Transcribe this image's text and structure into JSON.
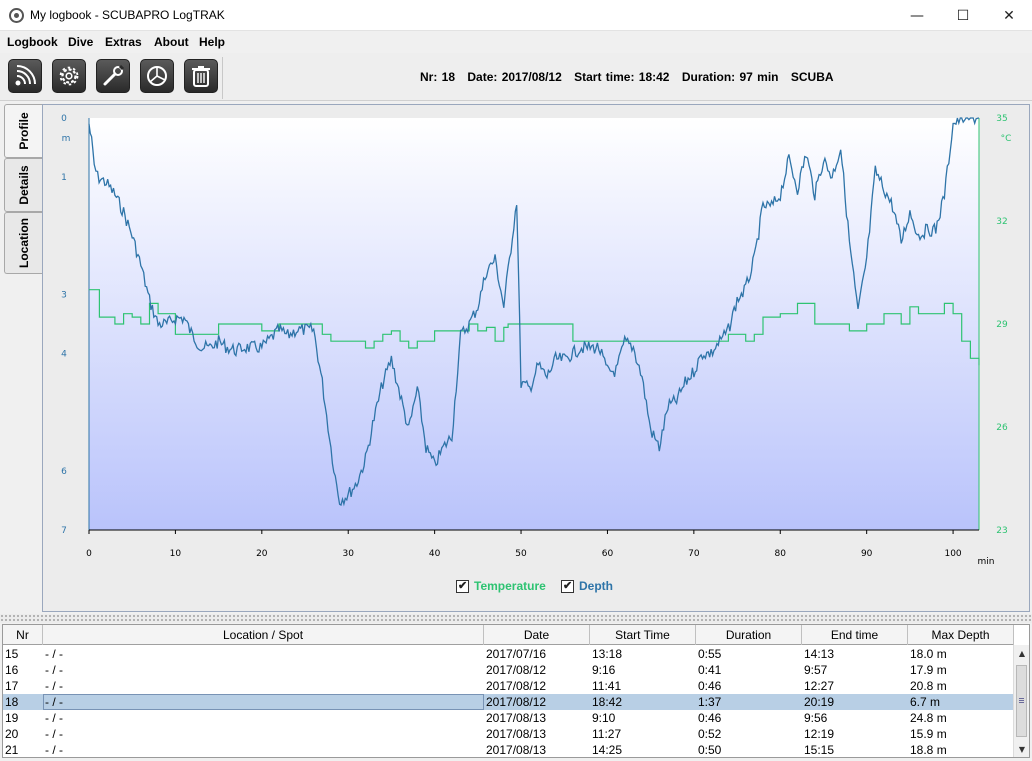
{
  "window": {
    "title": "My logbook - SCUBAPRO LogTRAK",
    "minimize": "—",
    "maximize": "☐",
    "close": "✕"
  },
  "menu": [
    "Logbook",
    "Dive",
    "Extras",
    "About",
    "Help"
  ],
  "toolbar": {
    "buttons": [
      "connect-device-icon",
      "settings-gear-icon",
      "wrench-tools-icon",
      "statistics-pie-icon",
      "delete-trash-icon"
    ],
    "dive_info": {
      "nr": "Nr: 18",
      "date": "Date: 2017/08/12",
      "start_time": "Start time: 18:42",
      "duration": "Duration: 97 min",
      "mode": "SCUBA"
    }
  },
  "side_tabs": [
    "Profile",
    "Details",
    "Location"
  ],
  "active_tab": "Profile",
  "legend": {
    "temperature": "Temperature",
    "depth": "Depth",
    "temperature_checked": true,
    "depth_checked": true
  },
  "colors": {
    "depth": "#2e74a8",
    "temperature": "#2ec372",
    "selected_row": "#b8cfe5"
  },
  "chart_data": {
    "type": "line",
    "x_unit": "min",
    "y_left_unit": "m",
    "y_right_unit": "°C",
    "xlim": [
      0,
      103
    ],
    "ylim_depth": [
      7,
      0
    ],
    "ylim_temp": [
      23,
      35
    ],
    "x_ticks": [
      0,
      10,
      20,
      30,
      40,
      50,
      60,
      70,
      80,
      90,
      100
    ],
    "y_left_ticks": [
      0,
      1,
      3,
      4,
      6,
      7
    ],
    "y_right_ticks": [
      35,
      32,
      29,
      26,
      23
    ],
    "series": [
      {
        "name": "Depth",
        "x": [
          0,
          0.3,
          0.6,
          1,
          2,
          3,
          4,
          5,
          6,
          7,
          8,
          9,
          10,
          11,
          12,
          13,
          14,
          15,
          16,
          17,
          18,
          19,
          20,
          21,
          22,
          23,
          24,
          25,
          26,
          27,
          28,
          28.5,
          29,
          30,
          31,
          32,
          33,
          34,
          35,
          36,
          37,
          38,
          39,
          40,
          41,
          42,
          43,
          44,
          45,
          46,
          47,
          48,
          49,
          49.5,
          50,
          51,
          52,
          53,
          54,
          55,
          56,
          57,
          58,
          59,
          60,
          61,
          62,
          63,
          64,
          65,
          66,
          67,
          68,
          69,
          70,
          71,
          72,
          73,
          74,
          75,
          76,
          77,
          78,
          79,
          80,
          81,
          82,
          83,
          84,
          85,
          86,
          87,
          88,
          89,
          90,
          91,
          92,
          93,
          94,
          95,
          96,
          97,
          98,
          99,
          100,
          101,
          102,
          103
        ],
        "y": [
          0.1,
          0.4,
          0.8,
          1.0,
          1.1,
          1.3,
          1.6,
          2.0,
          2.5,
          3.1,
          3.5,
          3.5,
          3.4,
          3.4,
          3.7,
          3.9,
          3.9,
          3.8,
          3.9,
          3.95,
          3.9,
          3.9,
          3.9,
          3.75,
          3.6,
          3.7,
          3.6,
          3.6,
          3.6,
          4.5,
          5.6,
          6.1,
          6.5,
          6.4,
          6.2,
          5.8,
          5.1,
          4.5,
          4.1,
          4.7,
          5.3,
          4.6,
          5.6,
          5.9,
          5.6,
          5.4,
          3.7,
          3.5,
          3.2,
          2.6,
          2.4,
          3.2,
          2.0,
          1.4,
          4.5,
          4.6,
          4.2,
          4.4,
          4.1,
          4.1,
          4.0,
          3.9,
          3.9,
          3.9,
          4.3,
          4.3,
          3.8,
          3.9,
          4.4,
          5.3,
          5.6,
          4.9,
          4.8,
          4.5,
          4.3,
          4.0,
          4.0,
          3.8,
          3.6,
          3.1,
          2.9,
          2.4,
          1.5,
          1.5,
          1.3,
          0.7,
          1.2,
          0.6,
          1.3,
          0.7,
          1.0,
          0.5,
          2.1,
          3.3,
          2.4,
          0.9,
          1.2,
          1.5,
          2.1,
          1.6,
          2.0,
          1.9,
          1.9,
          1.3,
          0.1,
          0.0,
          0.0,
          0.0
        ]
      },
      {
        "name": "Temperature",
        "x": [
          0,
          1,
          1.2,
          2,
          3,
          4,
          5,
          6,
          7,
          8,
          10,
          12,
          15,
          18,
          20,
          22,
          24,
          25,
          27,
          28,
          29,
          30,
          31,
          32,
          33,
          34,
          35,
          36,
          37,
          38,
          40,
          42,
          44,
          45,
          46,
          47,
          48,
          48.5,
          50,
          55,
          56,
          58,
          60,
          65,
          70,
          74,
          75,
          76,
          77,
          78,
          80,
          82,
          84,
          86,
          88,
          90,
          92,
          94,
          95,
          96,
          98,
          99,
          100,
          101,
          102,
          103
        ],
        "y": [
          30.0,
          30.0,
          29.2,
          29.2,
          29.0,
          29.3,
          29.2,
          29.0,
          29.6,
          29.3,
          28.7,
          28.7,
          29.0,
          29.0,
          28.8,
          29.0,
          29.0,
          29.0,
          28.7,
          28.5,
          28.5,
          28.5,
          28.5,
          28.3,
          28.5,
          28.7,
          28.8,
          28.5,
          28.3,
          28.5,
          28.8,
          28.8,
          29.0,
          28.8,
          28.9,
          28.5,
          28.9,
          29.0,
          29.0,
          29.0,
          28.5,
          28.5,
          28.5,
          28.5,
          28.5,
          28.7,
          28.7,
          28.5,
          28.7,
          29.2,
          29.3,
          29.6,
          29.0,
          29.0,
          28.8,
          29.0,
          29.3,
          29.0,
          29.5,
          29.3,
          29.3,
          29.6,
          29.3,
          28.5,
          28.0,
          27.8
        ]
      }
    ]
  },
  "table": {
    "columns": [
      "Nr",
      "Location / Spot",
      "Date",
      "Start Time",
      "Duration",
      "End time",
      "Max Depth"
    ],
    "rows": [
      [
        "15",
        "- / -",
        "2017/07/16",
        "13:18",
        "0:55",
        "14:13",
        "18.0 m"
      ],
      [
        "16",
        "- / -",
        "2017/08/12",
        "9:16",
        "0:41",
        "9:57",
        "17.9 m"
      ],
      [
        "17",
        "- / -",
        "2017/08/12",
        "11:41",
        "0:46",
        "12:27",
        "20.8 m"
      ],
      [
        "18",
        "- / -",
        "2017/08/12",
        "18:42",
        "1:37",
        "20:19",
        "6.7 m"
      ],
      [
        "19",
        "- / -",
        "2017/08/13",
        "9:10",
        "0:46",
        "9:56",
        "24.8 m"
      ],
      [
        "20",
        "- / -",
        "2017/08/13",
        "11:27",
        "0:52",
        "12:19",
        "15.9 m"
      ],
      [
        "21",
        "- / -",
        "2017/08/13",
        "14:25",
        "0:50",
        "15:15",
        "18.8 m"
      ]
    ],
    "selected_index": 3
  }
}
